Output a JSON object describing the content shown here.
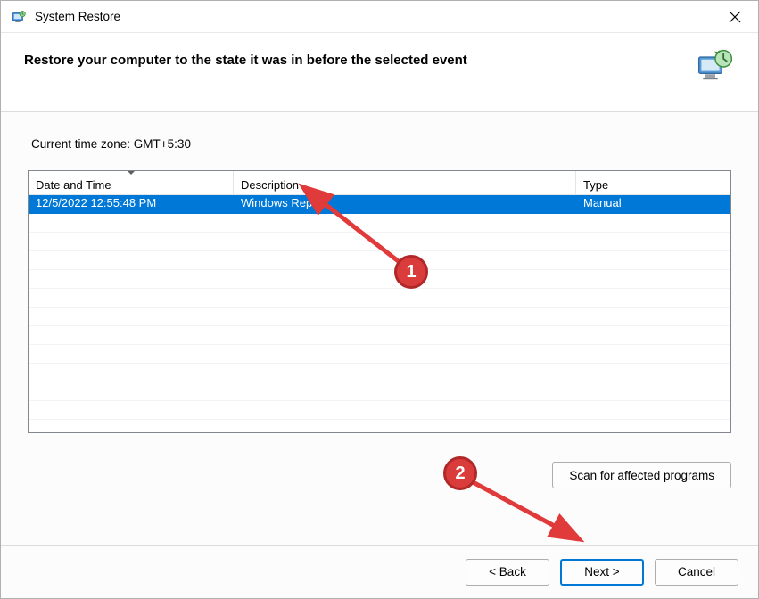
{
  "window": {
    "title": "System Restore"
  },
  "header": {
    "heading": "Restore your computer to the state it was in before the selected event"
  },
  "timezone_label": "Current time zone: GMT+5:30",
  "columns": {
    "date_time": "Date and Time",
    "description": "Description",
    "type": "Type"
  },
  "rows": [
    {
      "date_time": "12/5/2022 12:55:48 PM",
      "description": "Windows Report",
      "type": "Manual",
      "selected": true
    }
  ],
  "buttons": {
    "scan": "Scan for affected programs",
    "back": "< Back",
    "next": "Next >",
    "cancel": "Cancel"
  },
  "annotations": {
    "badge1": "1",
    "badge2": "2"
  }
}
